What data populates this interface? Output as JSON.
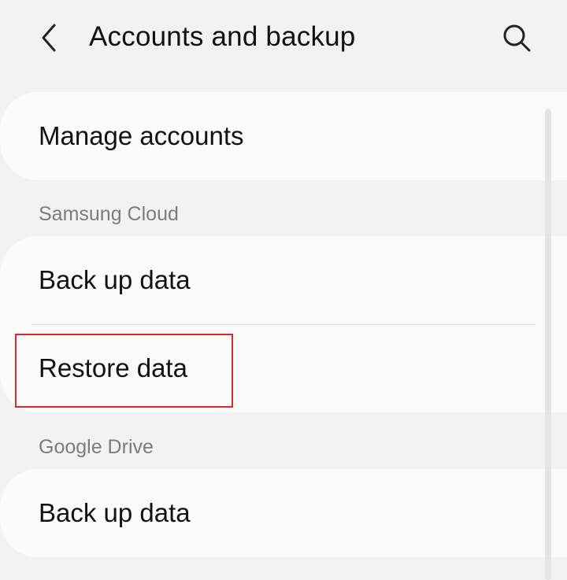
{
  "header": {
    "title": "Accounts and backup",
    "back_icon": "chevron-left-icon",
    "search_icon": "search-icon"
  },
  "main": {
    "manage_accounts": "Manage accounts",
    "sections": [
      {
        "header": "Samsung Cloud",
        "items": [
          "Back up data",
          "Restore data"
        ]
      },
      {
        "header": "Google Drive",
        "items": [
          "Back up data"
        ]
      }
    ]
  },
  "annotation": {
    "highlight_color": "#d62b2b"
  }
}
